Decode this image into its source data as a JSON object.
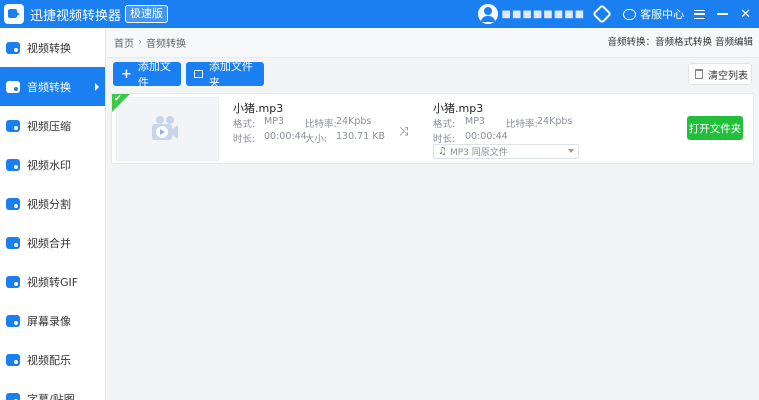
{
  "titlebar": {
    "app_title": "迅捷视频转换器",
    "edition": "极速版",
    "username": "■■■■■■■■",
    "service_label": "客服中心",
    "close_glyph": "✕"
  },
  "sidebar": {
    "items": [
      {
        "label": "视频转换",
        "icon": "video-convert-icon"
      },
      {
        "label": "音频转换",
        "icon": "audio-convert-icon"
      },
      {
        "label": "视频压缩",
        "icon": "compress-icon"
      },
      {
        "label": "视频水印",
        "icon": "watermark-icon"
      },
      {
        "label": "视频分割",
        "icon": "split-icon"
      },
      {
        "label": "视频合并",
        "icon": "merge-icon"
      },
      {
        "label": "视频转GIF",
        "icon": "gif-icon"
      },
      {
        "label": "屏幕录像",
        "icon": "record-icon"
      },
      {
        "label": "视频配乐",
        "icon": "music-icon"
      },
      {
        "label": "字幕/贴图",
        "icon": "subtitle-icon"
      }
    ],
    "active_index": 1
  },
  "breadcrumb": {
    "home": "首页",
    "sep": "›",
    "current": "音频转换",
    "right_text": "音频转换：音频格式转换  音频编辑"
  },
  "toolbar": {
    "add_file": "添加文件",
    "add_folder": "添加文件夹",
    "clear_list": "清空列表"
  },
  "file": {
    "source": {
      "name": "小猪.mp3",
      "format_label": "格式:",
      "format": "MP3",
      "bitrate_label": "比特率:",
      "bitrate": "24Kpbs",
      "duration_label": "时长:",
      "duration": "00:00:44",
      "size_label": "大小:",
      "size": "130.71 KB"
    },
    "output": {
      "name": "小猪.mp3",
      "format_label": "格式:",
      "format": "MP3",
      "bitrate_label": "比特率:",
      "bitrate": "24Kpbs",
      "duration_label": "时长:",
      "duration": "00:00:44",
      "select_value": "MP3   同原文件"
    },
    "open_folder": "打开文件夹",
    "check_glyph": "✔",
    "arrow_glyph": "⤨",
    "note_glyph": "♫",
    "plus_glyph": "+"
  },
  "colors": {
    "accent": "#1a7ff0",
    "success": "#22c03a"
  }
}
